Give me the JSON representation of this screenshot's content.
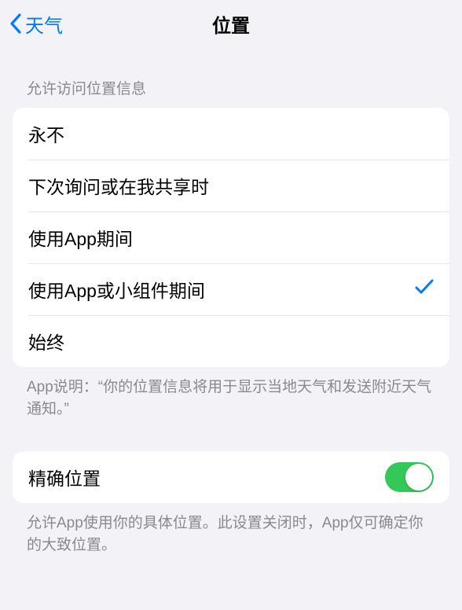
{
  "nav": {
    "back": "天气",
    "title": "位置"
  },
  "section1": {
    "header": "允许访问位置信息",
    "options": [
      {
        "label": "永不",
        "selected": false
      },
      {
        "label": "下次询问或在我共享时",
        "selected": false
      },
      {
        "label": "使用App期间",
        "selected": false
      },
      {
        "label": "使用App或小组件期间",
        "selected": true
      },
      {
        "label": "始终",
        "selected": false
      }
    ],
    "footer": "App说明：“你的位置信息将用于显示当地天气和发送附近天气通知。”"
  },
  "section2": {
    "precise_label": "精确位置",
    "precise_on": true,
    "footer": "允许App使用你的具体位置。此设置关闭时，App仅可确定你的大致位置。"
  }
}
